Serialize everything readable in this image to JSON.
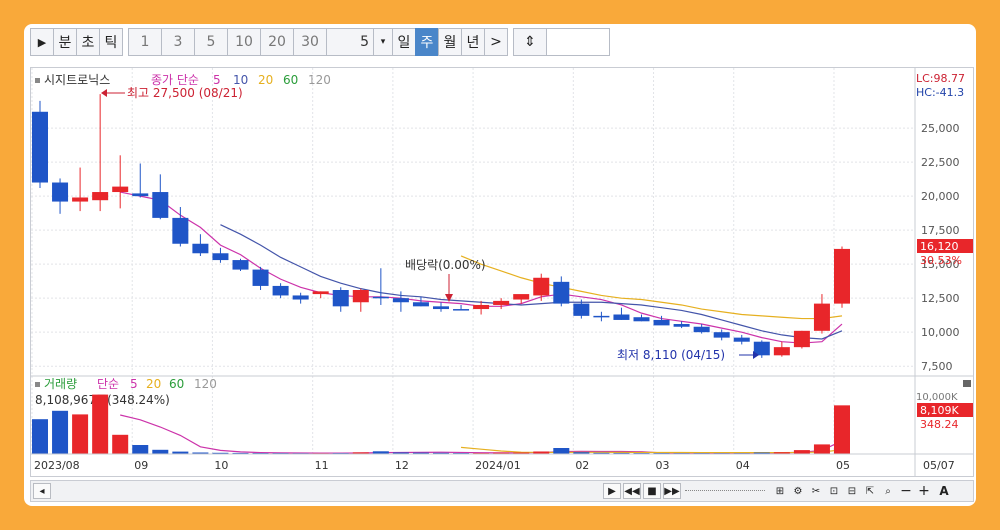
{
  "toolbar": {
    "play": "▶",
    "period_buttons": [
      {
        "label": "분",
        "active": false
      },
      {
        "label": "초",
        "active": false
      },
      {
        "label": "틱",
        "active": false
      }
    ],
    "interval_buttons": [
      "1",
      "3",
      "5",
      "10",
      "20",
      "30"
    ],
    "count_value": "5",
    "timeframe_buttons": [
      {
        "label": "일",
        "active": false
      },
      {
        "label": "주",
        "active": true
      },
      {
        "label": "월",
        "active": false
      },
      {
        "label": "년",
        "active": false
      }
    ],
    "next": ">",
    "expand": "⇕"
  },
  "price_panel": {
    "stock_name": "시지트로닉스",
    "indicator_label": "종가 단순",
    "ma_periods": [
      "5",
      "10",
      "20",
      "60",
      "120"
    ],
    "high_label": "최고 27,500 (08/21)",
    "low_label": "최저 8,110 (04/15)",
    "dividend_label": "배당락(0.00%)",
    "lc_label": "LC:98.77",
    "hc_label": "HC:-41.3",
    "current_price": "16,120",
    "change_pct": "30.53%",
    "y_ticks": [
      "25,000",
      "22,500",
      "20,000",
      "17,500",
      "15,000",
      "12,500",
      "10,000",
      "7,500"
    ]
  },
  "volume_panel": {
    "title": "거래량",
    "indicator_label": "단순",
    "ma_periods": [
      "5",
      "20",
      "60",
      "120"
    ],
    "last_volume_label": "8,108,967주(348.24%)",
    "y_top": "10,000K",
    "current_volume": "8,109K",
    "pct": "348.24"
  },
  "x_axis": {
    "labels": [
      "2023/08",
      "09",
      "10",
      "11",
      "12",
      "2024/01",
      "02",
      "03",
      "04",
      "05",
      "05/07"
    ]
  },
  "colors": {
    "up": "#e8262a",
    "down": "#1f55c7",
    "ma5": "#cc33aa",
    "ma10": "#4455aa",
    "ma20": "#e6b020",
    "ma60": "#2a9d3a",
    "ma120": "#999999"
  },
  "chart_data": [
    {
      "type": "candlestick",
      "title": "시지트로닉스",
      "period": "weekly",
      "x": [
        "2023-07-31",
        "2023-08-07",
        "2023-08-14",
        "2023-08-21",
        "2023-08-28",
        "2023-09-04",
        "2023-09-11",
        "2023-09-18",
        "2023-09-25",
        "2023-10-02",
        "2023-10-09",
        "2023-10-16",
        "2023-10-23",
        "2023-10-30",
        "2023-11-06",
        "2023-11-13",
        "2023-11-20",
        "2023-11-27",
        "2023-12-04",
        "2023-12-11",
        "2023-12-18",
        "2023-12-25",
        "2024-01-01",
        "2024-01-08",
        "2024-01-15",
        "2024-01-22",
        "2024-01-29",
        "2024-02-05",
        "2024-02-12",
        "2024-02-19",
        "2024-02-26",
        "2024-03-04",
        "2024-03-11",
        "2024-03-18",
        "2024-03-25",
        "2024-04-01",
        "2024-04-08",
        "2024-04-15",
        "2024-04-22",
        "2024-04-29",
        "2024-05-06"
      ],
      "open": [
        26200,
        21000,
        19600,
        19700,
        20300,
        20200,
        20300,
        18400,
        16500,
        15800,
        15300,
        14600,
        13400,
        12700,
        12800,
        13100,
        12200,
        12600,
        12500,
        12200,
        11900,
        11700,
        11700,
        12000,
        12400,
        12700,
        13700,
        12100,
        11200,
        11300,
        11100,
        10900,
        10600,
        10400,
        10000,
        9600,
        9300,
        8300,
        8900,
        10100,
        12100
      ],
      "high": [
        27000,
        21300,
        22100,
        27500,
        23000,
        22400,
        21600,
        19200,
        17200,
        16200,
        15400,
        14800,
        13600,
        12900,
        13000,
        13300,
        13200,
        14700,
        13000,
        12600,
        12200,
        12000,
        12300,
        12500,
        12700,
        14300,
        14100,
        12400,
        11500,
        11800,
        11300,
        11200,
        10800,
        10600,
        10200,
        9800,
        9400,
        9300,
        10100,
        12800,
        16300
      ],
      "low": [
        20600,
        18700,
        18900,
        18900,
        19100,
        19900,
        18300,
        16300,
        15600,
        15100,
        14500,
        13100,
        12500,
        12100,
        12500,
        11500,
        11500,
        12000,
        11500,
        11900,
        11500,
        11600,
        11300,
        11700,
        12100,
        12300,
        11900,
        11000,
        10800,
        10900,
        10800,
        10600,
        10300,
        9900,
        9400,
        9100,
        8110,
        8200,
        8800,
        9900,
        11800
      ],
      "close": [
        21000,
        19600,
        19900,
        20300,
        20700,
        20000,
        18400,
        16500,
        15800,
        15300,
        14600,
        13400,
        12700,
        12400,
        13000,
        11900,
        13100,
        12500,
        12200,
        11900,
        11700,
        11600,
        12000,
        12300,
        12800,
        14000,
        12100,
        11200,
        11100,
        10900,
        10800,
        10500,
        10400,
        10000,
        9600,
        9300,
        8300,
        8900,
        10100,
        12100,
        16120
      ],
      "ylim": [
        7000,
        27800
      ],
      "y_ticks": [
        7500,
        10000,
        12500,
        15000,
        17500,
        20000,
        22500,
        25000
      ],
      "moving_averages": {
        "5": [
          null,
          null,
          null,
          null,
          20300,
          20000,
          19700,
          18600,
          17700,
          16400,
          15700,
          14700,
          13900,
          13300,
          12900,
          12700,
          12600,
          12600,
          12500,
          12300,
          12200,
          12100,
          11900,
          11900,
          12100,
          12600,
          12800,
          12600,
          12400,
          12000,
          11400,
          11000,
          10800,
          10600,
          10300,
          10000,
          9600,
          9300,
          9200,
          9300,
          10600
        ],
        "10": [
          null,
          null,
          null,
          null,
          null,
          null,
          null,
          null,
          null,
          17900,
          17200,
          16400,
          15500,
          14800,
          14100,
          13600,
          13200,
          12900,
          12700,
          12600,
          12400,
          12300,
          12200,
          12100,
          12000,
          12100,
          12200,
          12200,
          12200,
          12100,
          12000,
          11800,
          11600,
          11300,
          10900,
          10500,
          10100,
          9800,
          9600,
          9500,
          10100
        ],
        "20": [
          null,
          null,
          null,
          null,
          null,
          null,
          null,
          null,
          null,
          null,
          null,
          null,
          null,
          null,
          null,
          null,
          null,
          null,
          null,
          null,
          null,
          15600,
          15000,
          14500,
          14000,
          13600,
          13300,
          13000,
          12700,
          12500,
          12400,
          12200,
          12000,
          11700,
          11500,
          11300,
          11200,
          11100,
          11000,
          11000,
          11200
        ]
      }
    },
    {
      "type": "bar",
      "title": "거래량",
      "x": [
        "2023-07-31",
        "2023-08-07",
        "2023-08-14",
        "2023-08-21",
        "2023-08-28",
        "2023-09-04",
        "2023-09-11",
        "2023-09-18",
        "2023-09-25",
        "2023-10-02",
        "2023-10-09",
        "2023-10-16",
        "2023-10-23",
        "2023-10-30",
        "2023-11-06",
        "2023-11-13",
        "2023-11-20",
        "2023-11-27",
        "2023-12-04",
        "2023-12-11",
        "2023-12-18",
        "2023-12-25",
        "2024-01-01",
        "2024-01-08",
        "2024-01-15",
        "2024-01-22",
        "2024-01-29",
        "2024-02-05",
        "2024-02-12",
        "2024-02-19",
        "2024-02-26",
        "2024-03-04",
        "2024-03-11",
        "2024-03-18",
        "2024-03-25",
        "2024-04-01",
        "2024-04-08",
        "2024-04-15",
        "2024-04-22",
        "2024-04-29",
        "2024-05-06"
      ],
      "values": [
        5800,
        7200,
        6600,
        9900,
        3200,
        1500,
        700,
        400,
        250,
        200,
        180,
        160,
        150,
        130,
        120,
        150,
        280,
        450,
        260,
        230,
        200,
        160,
        160,
        220,
        250,
        420,
        1000,
        300,
        200,
        180,
        160,
        160,
        150,
        150,
        140,
        140,
        240,
        300,
        650,
        1600,
        8109
      ],
      "unit": "K",
      "ylim": [
        0,
        10000
      ],
      "moving_averages": {
        "5": [
          null,
          null,
          null,
          null,
          6500,
          5700,
          4500,
          3100,
          1200,
          600,
          350,
          240,
          190,
          170,
          150,
          140,
          170,
          230,
          260,
          270,
          290,
          260,
          220,
          190,
          200,
          240,
          400,
          440,
          430,
          430,
          370,
          200,
          170,
          160,
          150,
          150,
          160,
          190,
          290,
          590,
          2200
        ],
        "20": [
          null,
          null,
          null,
          null,
          null,
          null,
          null,
          null,
          null,
          null,
          null,
          null,
          null,
          null,
          null,
          null,
          null,
          null,
          null,
          null,
          null,
          1100,
          800,
          500,
          300,
          260,
          270,
          280,
          280,
          270,
          260,
          250,
          250,
          240,
          240,
          230,
          230,
          240,
          260,
          330,
          700
        ]
      }
    }
  ]
}
